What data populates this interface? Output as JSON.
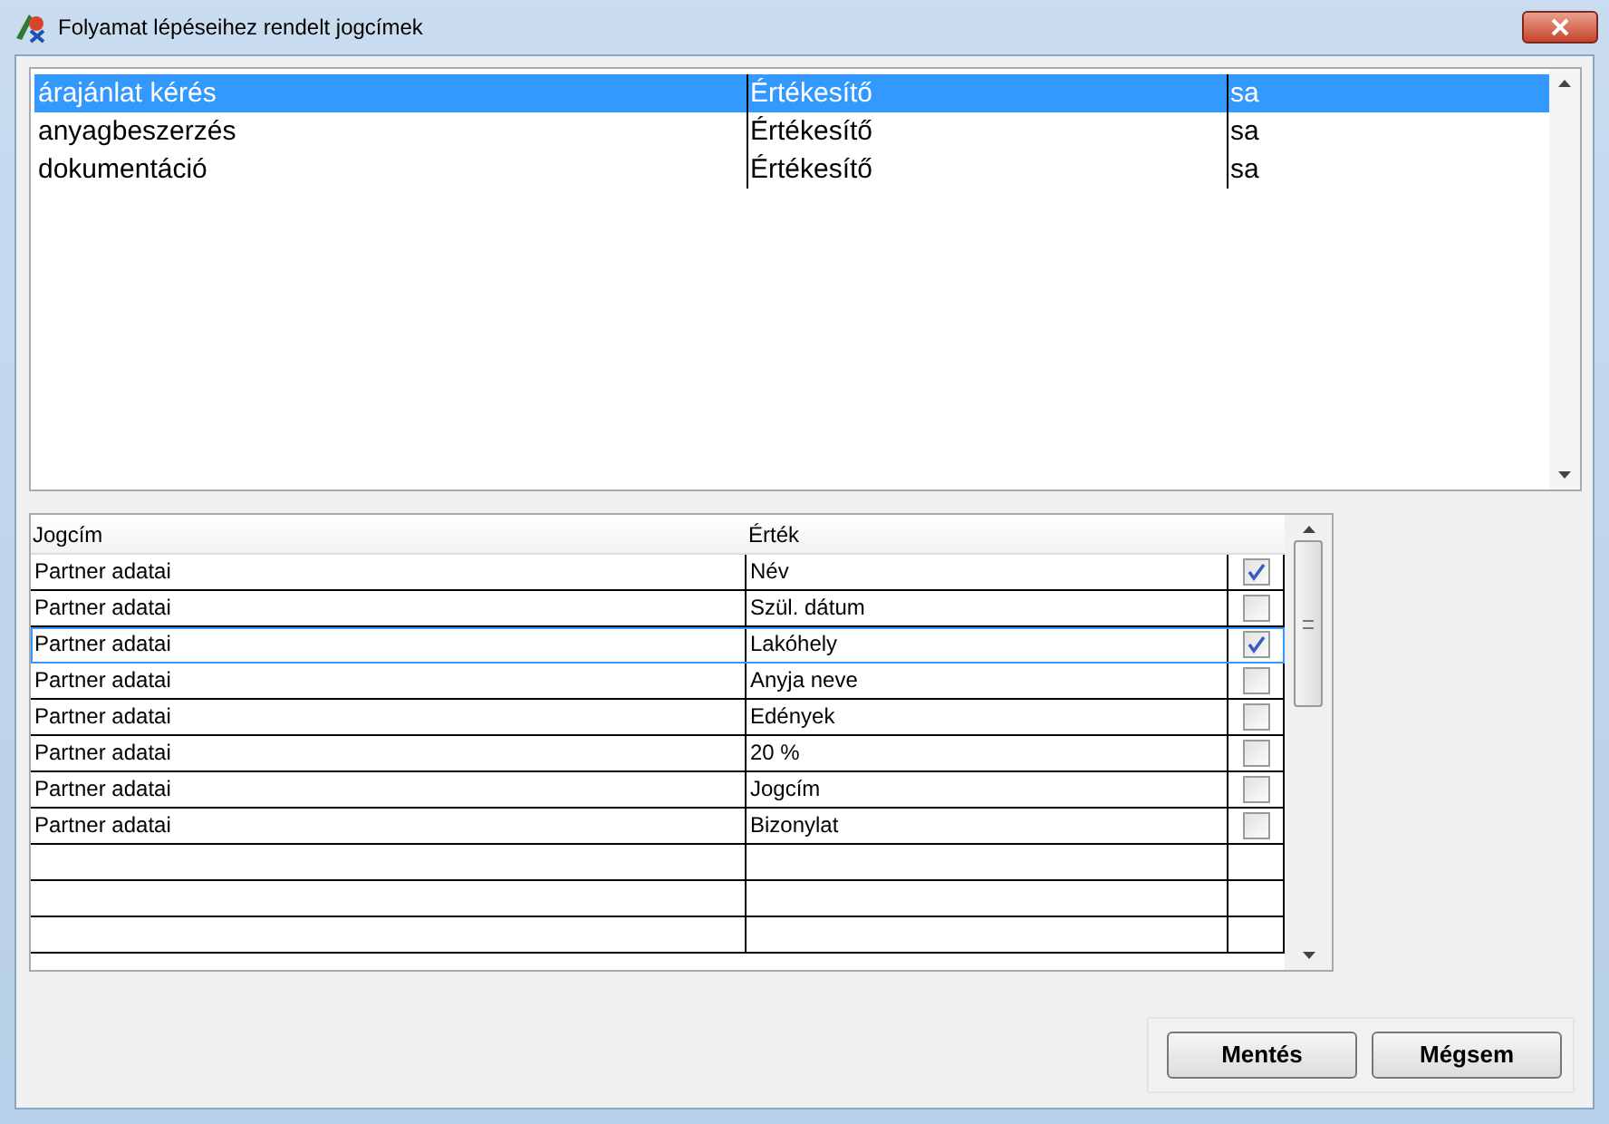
{
  "window": {
    "title": "Folyamat lépéseihez rendelt jogcímek"
  },
  "steps": [
    {
      "name": "árajánlat kérés",
      "role": "Értékesítő",
      "user": "sa",
      "selected": true
    },
    {
      "name": "anyagbeszerzés",
      "role": "Értékesítő",
      "user": "sa",
      "selected": false
    },
    {
      "name": "dokumentáció",
      "role": "Értékesítő",
      "user": "sa",
      "selected": false
    }
  ],
  "grid": {
    "columns": [
      "Jogcím",
      "Érték"
    ],
    "rows": [
      {
        "jogcim": "Partner adatai",
        "ertek": "Név",
        "checked": true,
        "selected": false
      },
      {
        "jogcim": "Partner adatai",
        "ertek": "Szül. dátum",
        "checked": false,
        "selected": false
      },
      {
        "jogcim": "Partner adatai",
        "ertek": "Lakóhely",
        "checked": true,
        "selected": true
      },
      {
        "jogcim": "Partner adatai",
        "ertek": "Anyja neve",
        "checked": false,
        "selected": false
      },
      {
        "jogcim": "Partner adatai",
        "ertek": "Edények",
        "checked": false,
        "selected": false
      },
      {
        "jogcim": "Partner adatai",
        "ertek": "20 %",
        "checked": false,
        "selected": false
      },
      {
        "jogcim": "Partner adatai",
        "ertek": "Jogcím",
        "checked": false,
        "selected": false
      },
      {
        "jogcim": "Partner adatai",
        "ertek": "Bizonylat",
        "checked": false,
        "selected": false
      }
    ]
  },
  "buttons": [
    "Mentés",
    "Mégsem"
  ]
}
